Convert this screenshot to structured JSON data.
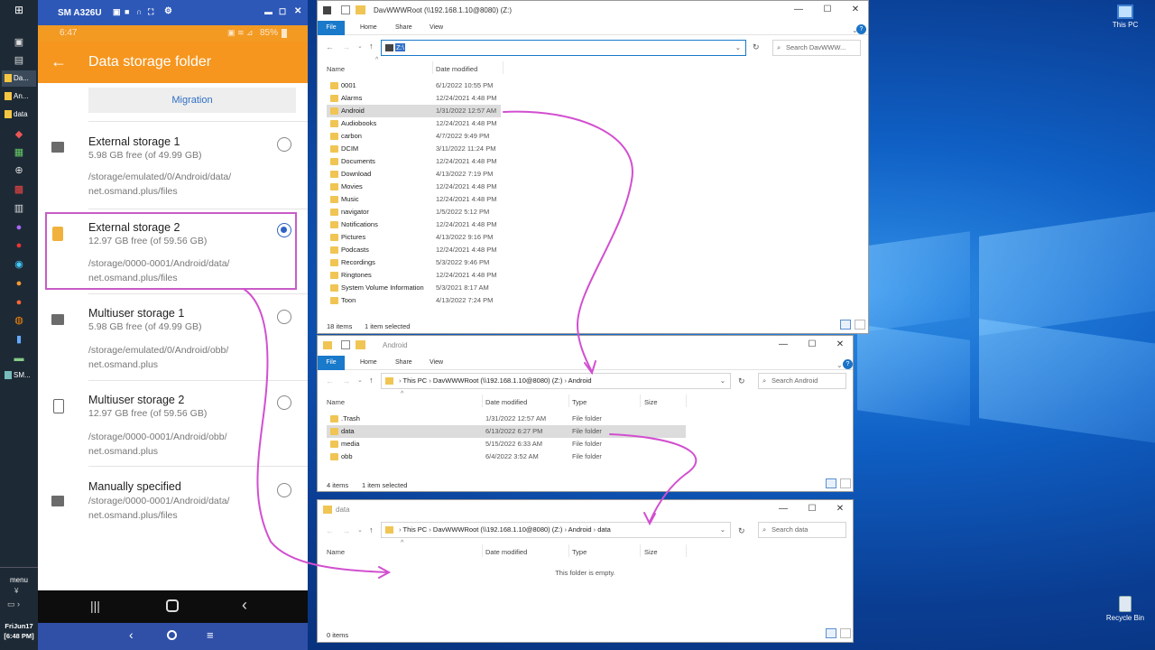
{
  "desktop": {
    "icons": [
      {
        "label": "This PC"
      },
      {
        "label": "Recycle Bin"
      }
    ]
  },
  "taskbar": {
    "apps": [
      {
        "label": "Da..."
      },
      {
        "label": "An..."
      },
      {
        "label": "data"
      },
      {
        "label": "SM..."
      }
    ],
    "menu_label": "menu",
    "date": "FriJun17",
    "time": "[6:48 PM]"
  },
  "phone": {
    "window_title": "SM A326U",
    "status_time": "6:47",
    "battery": "85%",
    "app_title": "Data storage folder",
    "migration_label": "Migration",
    "options": [
      {
        "name": "External storage 1",
        "free": "5.98 GB free (of 49.99 GB)",
        "path1": "/storage/emulated/0/Android/data/",
        "path2": "net.osmand.plus/files",
        "selected": false
      },
      {
        "name": "External storage 2",
        "free": "12.97 GB free (of 59.56 GB)",
        "path1": "/storage/0000-0001/Android/data/",
        "path2": "net.osmand.plus/files",
        "selected": true
      },
      {
        "name": "Multiuser storage 1",
        "free": "5.98 GB free (of 49.99 GB)",
        "path1": "/storage/emulated/0/Android/obb/",
        "path2": "net.osmand.plus",
        "selected": false
      },
      {
        "name": "Multiuser storage 2",
        "free": "12.97 GB free (of 59.56 GB)",
        "path1": "/storage/0000-0001/Android/obb/",
        "path2": "net.osmand.plus",
        "selected": false
      },
      {
        "name": "Manually specified",
        "free": "",
        "path1": "/storage/0000-0001/Android/data/",
        "path2": "net.osmand.plus/files",
        "selected": false
      }
    ]
  },
  "ribbon": {
    "file": "File",
    "home": "Home",
    "share": "Share",
    "view": "View"
  },
  "win1": {
    "title": "DavWWWRoot (\\\\192.168.1.10@8080) (Z:)",
    "address": "Z:\\",
    "search_placeholder": "Search DavWWW...",
    "col_name": "Name",
    "col_date": "Date modified",
    "rows": [
      {
        "name": "0001",
        "date": "6/1/2022 10:55 PM"
      },
      {
        "name": "Alarms",
        "date": "12/24/2021 4:48 PM"
      },
      {
        "name": "Android",
        "date": "1/31/2022 12:57 AM"
      },
      {
        "name": "Audiobooks",
        "date": "12/24/2021 4:48 PM"
      },
      {
        "name": "carbon",
        "date": "4/7/2022 9:49 PM"
      },
      {
        "name": "DCIM",
        "date": "3/11/2022 11:24 PM"
      },
      {
        "name": "Documents",
        "date": "12/24/2021 4:48 PM"
      },
      {
        "name": "Download",
        "date": "4/13/2022 7:19 PM"
      },
      {
        "name": "Movies",
        "date": "12/24/2021 4:48 PM"
      },
      {
        "name": "Music",
        "date": "12/24/2021 4:48 PM"
      },
      {
        "name": "navigator",
        "date": "1/5/2022 5:12 PM"
      },
      {
        "name": "Notifications",
        "date": "12/24/2021 4:48 PM"
      },
      {
        "name": "Pictures",
        "date": "4/13/2022 9:16 PM"
      },
      {
        "name": "Podcasts",
        "date": "12/24/2021 4:48 PM"
      },
      {
        "name": "Recordings",
        "date": "5/3/2022 9:46 PM"
      },
      {
        "name": "Ringtones",
        "date": "12/24/2021 4:48 PM"
      },
      {
        "name": "System Volume Information",
        "date": "5/3/2021 8:17 AM"
      },
      {
        "name": "Toon",
        "date": "4/13/2022 7:24 PM"
      }
    ],
    "selected_index": 2,
    "status_items": "18 items",
    "status_selected": "1 item selected"
  },
  "win2": {
    "title": "Android",
    "crumbs": [
      "This PC",
      "DavWWWRoot (\\\\192.168.1.10@8080) (Z:)",
      "Android"
    ],
    "search_placeholder": "Search Android",
    "col_name": "Name",
    "col_date": "Date modified",
    "col_type": "Type",
    "col_size": "Size",
    "rows": [
      {
        "name": ".Trash",
        "date": "1/31/2022 12:57 AM",
        "type": "File folder"
      },
      {
        "name": "data",
        "date": "6/13/2022 6:27 PM",
        "type": "File folder"
      },
      {
        "name": "media",
        "date": "5/15/2022 6:33 AM",
        "type": "File folder"
      },
      {
        "name": "obb",
        "date": "6/4/2022 3:52 AM",
        "type": "File folder"
      }
    ],
    "selected_index": 1,
    "status_items": "4 items",
    "status_selected": "1 item selected"
  },
  "win3": {
    "title": "data",
    "crumbs": [
      "This PC",
      "DavWWWRoot (\\\\192.168.1.10@8080) (Z:)",
      "Android",
      "data"
    ],
    "search_placeholder": "Search data",
    "col_name": "Name",
    "col_date": "Date modified",
    "col_type": "Type",
    "col_size": "Size",
    "empty_text": "This folder is empty.",
    "status_items": "0 items"
  },
  "colors": {
    "arrow": "#d24fd0",
    "phone_orange": "#f6961e",
    "explorer_blue": "#1979ca"
  }
}
